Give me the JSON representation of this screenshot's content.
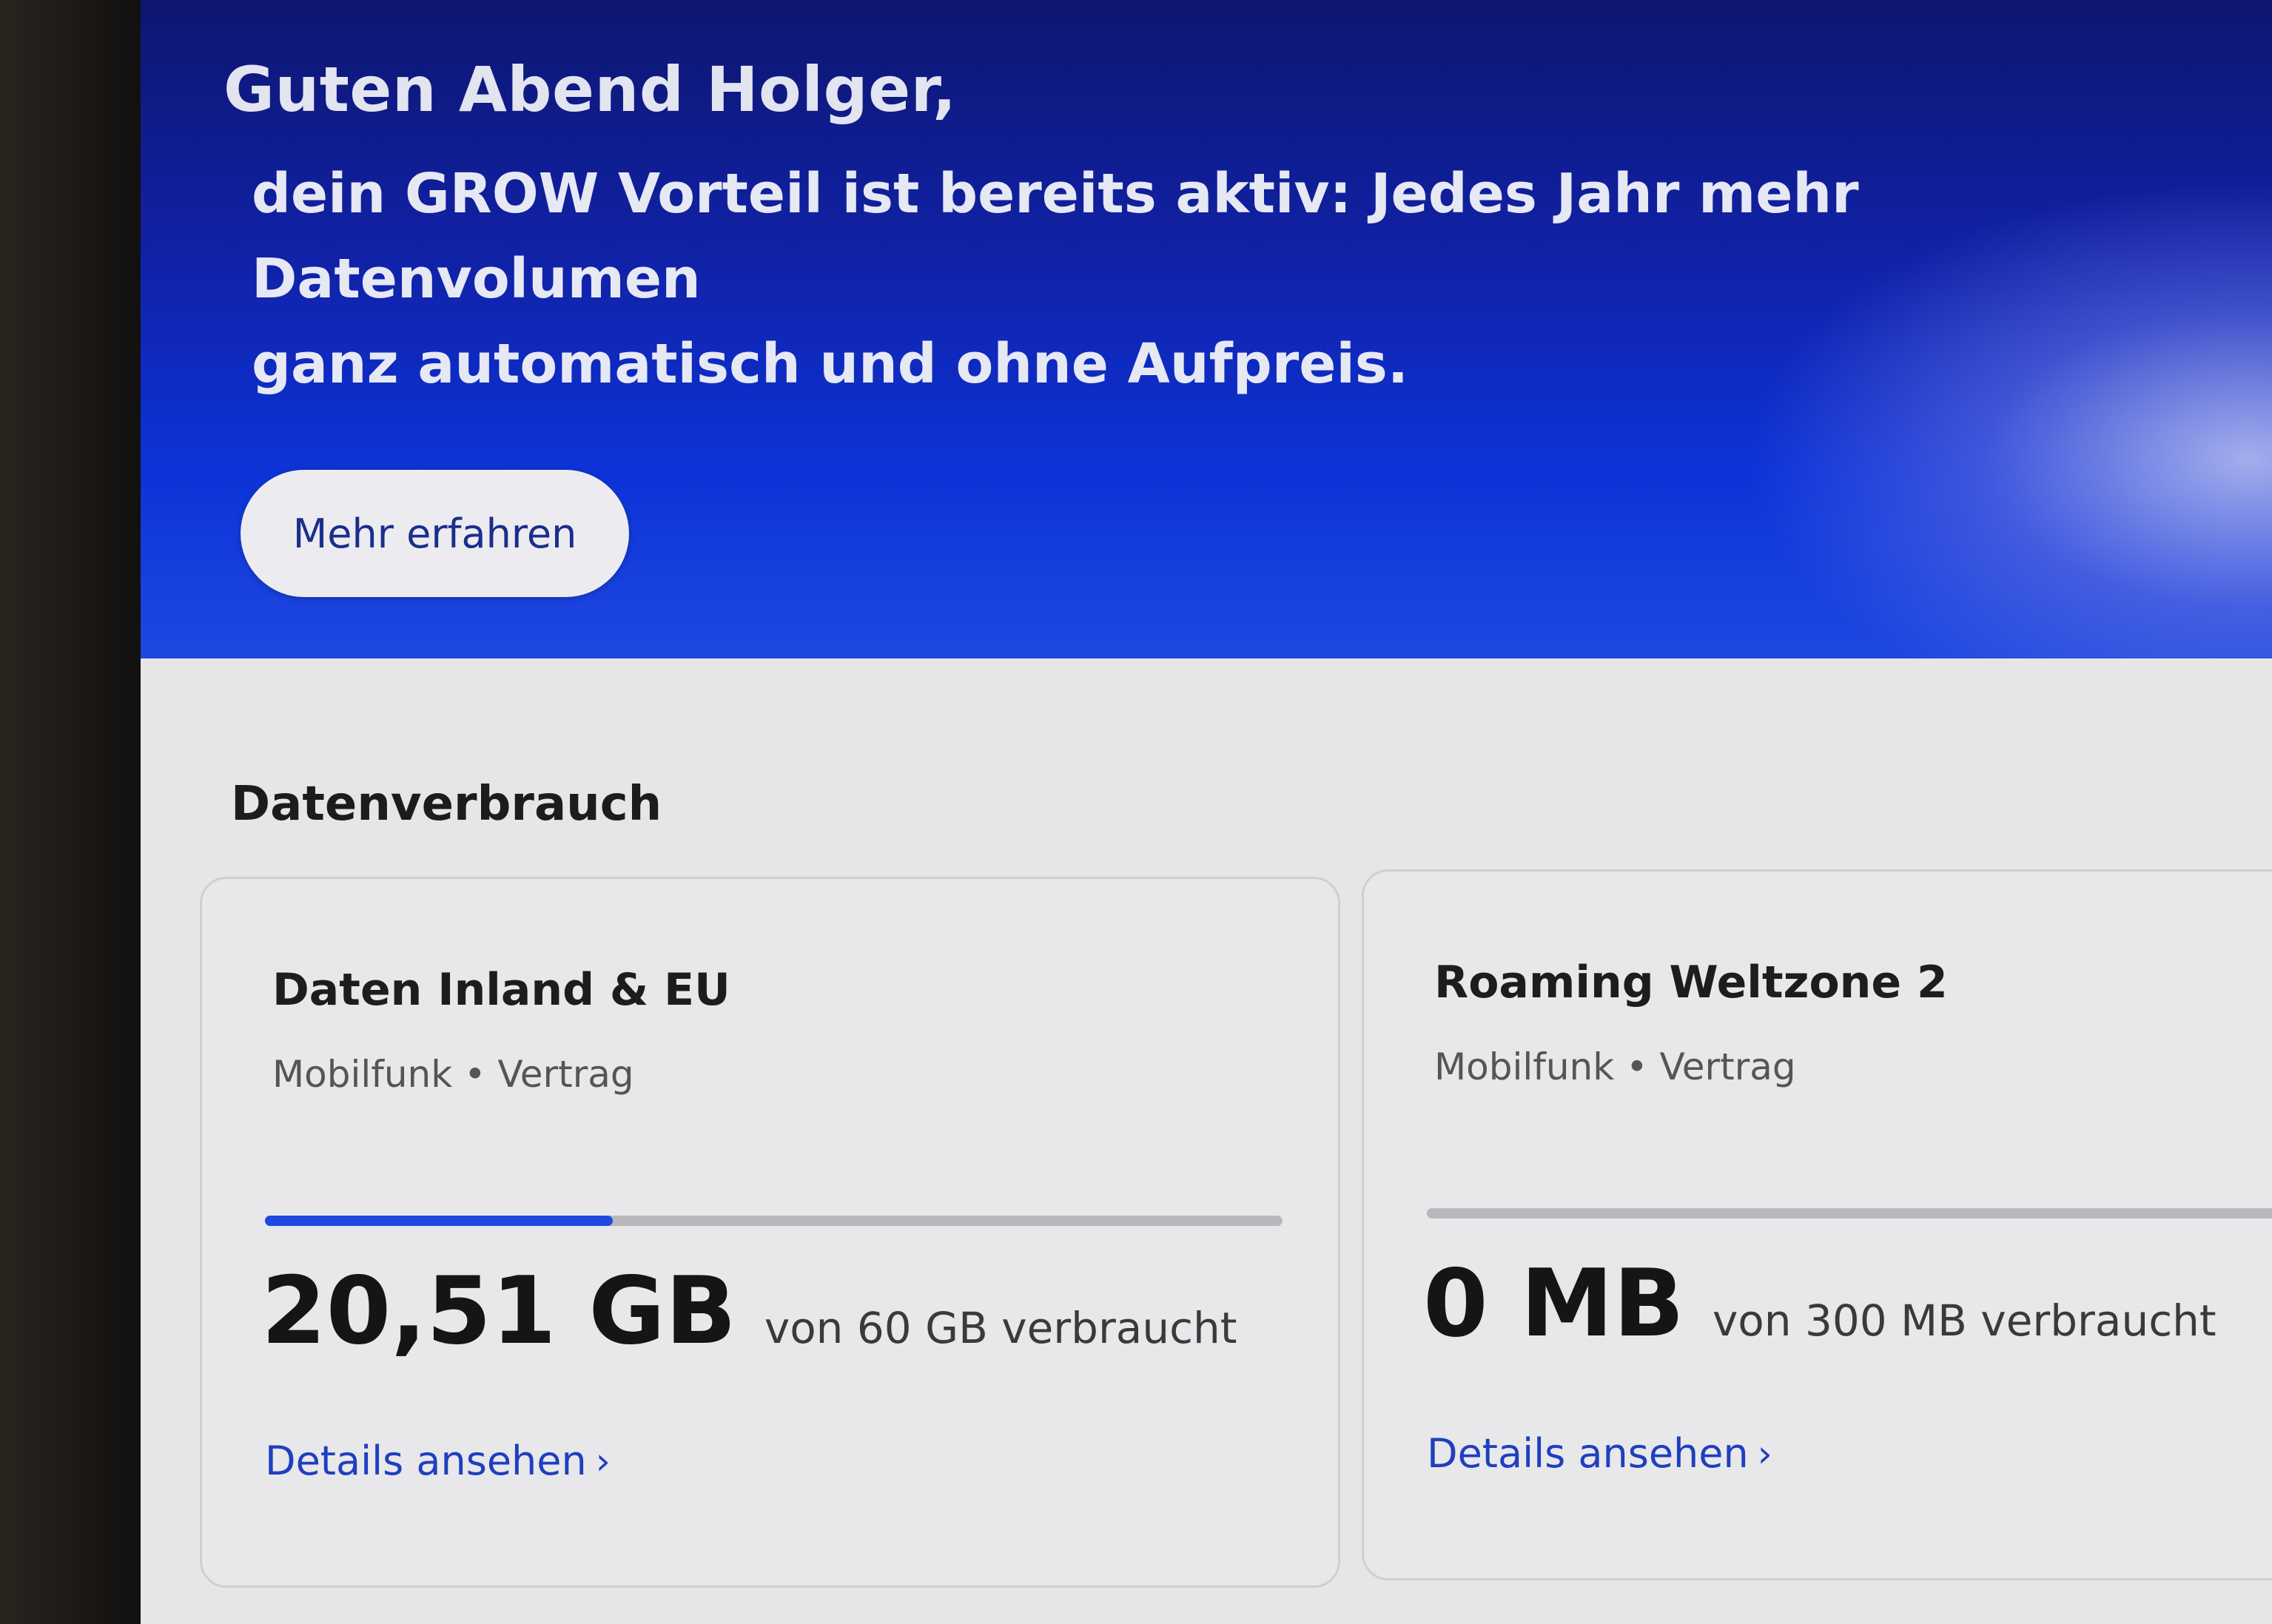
{
  "hero": {
    "greeting": "Guten Abend Holger,",
    "promo": "dein GROW Vorteil ist bereits aktiv: Jedes Jahr mehr Datenvolumen\nganz automatisch und ohne Aufpreis.",
    "cta_label": "Mehr erfahren"
  },
  "data_usage": {
    "section_title": "Datenverbrauch",
    "cards": [
      {
        "title": "Daten Inland & EU",
        "subtitle": "Mobilfunk • Vertrag",
        "used": "20,51 GB",
        "of_text": "von 60 GB verbraucht",
        "used_fraction": 0.342,
        "details_label": "Details ansehen",
        "chevron_icon": "chevron-right-icon"
      },
      {
        "title": "Roaming Weltzone 2",
        "subtitle": "Mobilfunk • Vertrag",
        "used": "0 MB",
        "of_text": "von 300 MB verbraucht",
        "used_fraction": 0,
        "details_label": "Details ansehen",
        "chevron_icon": "chevron-right-icon"
      }
    ]
  },
  "colors": {
    "hero_blue": "#0d33d8",
    "progress_fill": "#1f49e0",
    "link": "#1e3fc0"
  }
}
